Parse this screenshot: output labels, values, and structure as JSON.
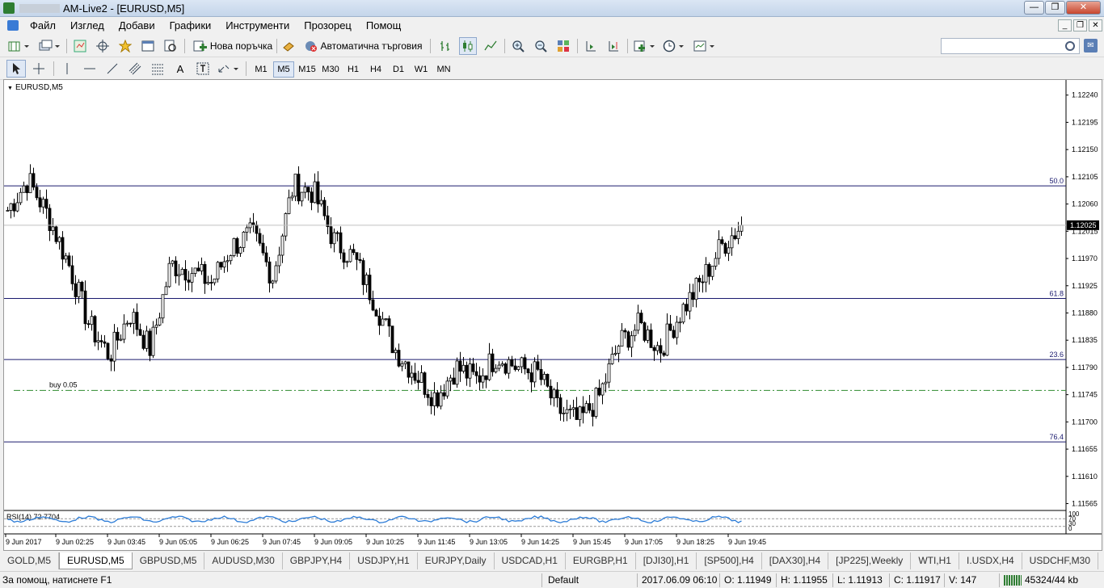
{
  "window": {
    "title_suffix": "AM-Live2 - [EURUSD,M5]",
    "buttons": {
      "minimize": "—",
      "maximize": "❐",
      "close": "✕"
    }
  },
  "menu": [
    "Файл",
    "Изглед",
    "Добави",
    "Графики",
    "Инструменти",
    "Прозорец",
    "Помощ"
  ],
  "toolbar": {
    "new_order": "Нова поръчка",
    "auto_trading": "Автоматична търговия",
    "search_placeholder": ""
  },
  "timeframes": [
    "M1",
    "M5",
    "M15",
    "M30",
    "H1",
    "H4",
    "D1",
    "W1",
    "MN"
  ],
  "active_timeframe": "M5",
  "chart": {
    "symbol": "EURUSD,M5",
    "current_price": "1.12025",
    "price_labels": [
      "1.12240",
      "1.12195",
      "1.12150",
      "1.12105",
      "1.12060",
      "1.12015",
      "1.11970",
      "1.11925",
      "1.11880",
      "1.11835",
      "1.11790",
      "1.11745",
      "1.11700",
      "1.11655",
      "1.11610",
      "1.11565"
    ],
    "fib_levels": [
      {
        "label": "50.0",
        "price": 1.1209
      },
      {
        "label": "61.8",
        "price": 1.11904
      },
      {
        "label": "23.6",
        "price": 1.11803
      },
      {
        "label": "76.4",
        "price": 1.11667
      }
    ],
    "order_line": {
      "label": "buy  0.05",
      "price": 1.11752
    },
    "rsi_label": "RSI(14) 72.7704",
    "rsi_scale": [
      "100",
      "70",
      "30",
      "0"
    ],
    "time_labels": [
      "9 Jun 2017",
      "9 Jun 02:25",
      "9 Jun 03:45",
      "9 Jun 05:05",
      "9 Jun 06:25",
      "9 Jun 07:45",
      "9 Jun 09:05",
      "9 Jun 10:25",
      "9 Jun 11:45",
      "9 Jun 13:05",
      "9 Jun 14:25",
      "9 Jun 15:45",
      "9 Jun 17:05",
      "9 Jun 18:25",
      "9 Jun 19:45"
    ]
  },
  "chart_data": {
    "type": "candlestick",
    "symbol": "EURUSD",
    "timeframe": "M5",
    "ylim": [
      1.11555,
      1.12265
    ],
    "anchor_closes": [
      1.1205,
      1.121,
      1.1204,
      1.1196,
      1.1186,
      1.1181,
      1.1188,
      1.1182,
      1.1196,
      1.1195,
      1.1193,
      1.1199,
      1.1201,
      1.1194,
      1.1209,
      1.1208,
      1.12,
      1.1197,
      1.119,
      1.1182,
      1.1178,
      1.1174,
      1.1179,
      1.1177,
      1.1181,
      1.1179,
      1.1178,
      1.1172,
      1.117,
      1.1174,
      1.1183,
      1.1186,
      1.1182,
      1.1188,
      1.1193,
      1.1199,
      1.12025
    ],
    "last_close": 1.12025
  },
  "tabs": [
    "GOLD,M5",
    "EURUSD,M5",
    "GBPUSD,M5",
    "AUDUSD,M30",
    "GBPJPY,H4",
    "USDJPY,H1",
    "EURJPY,Daily",
    "USDCAD,H1",
    "EURGBP,H1",
    "[DJI30],H1",
    "[SP500],H4",
    "[DAX30],H4",
    "[JP225],Weekly",
    "WTI,H1",
    "I.USDX,H4",
    "USDCHF,M30"
  ],
  "active_tab": "EURUSD,M5",
  "status": {
    "help": "За помощ, натиснете F1",
    "profile": "Default",
    "datetime": "2017.06.09 06:10",
    "open": "O: 1.11949",
    "high": "H: 1.11955",
    "low": "L: 1.11913",
    "close": "C: 1.11917",
    "volume": "V: 147",
    "traffic": "45324/44 kb"
  },
  "colors": {
    "fib_line": "#1a1a6e",
    "order_line": "#2e8b2e",
    "rsi_line": "#2b7bd6",
    "candle": "#000000"
  }
}
